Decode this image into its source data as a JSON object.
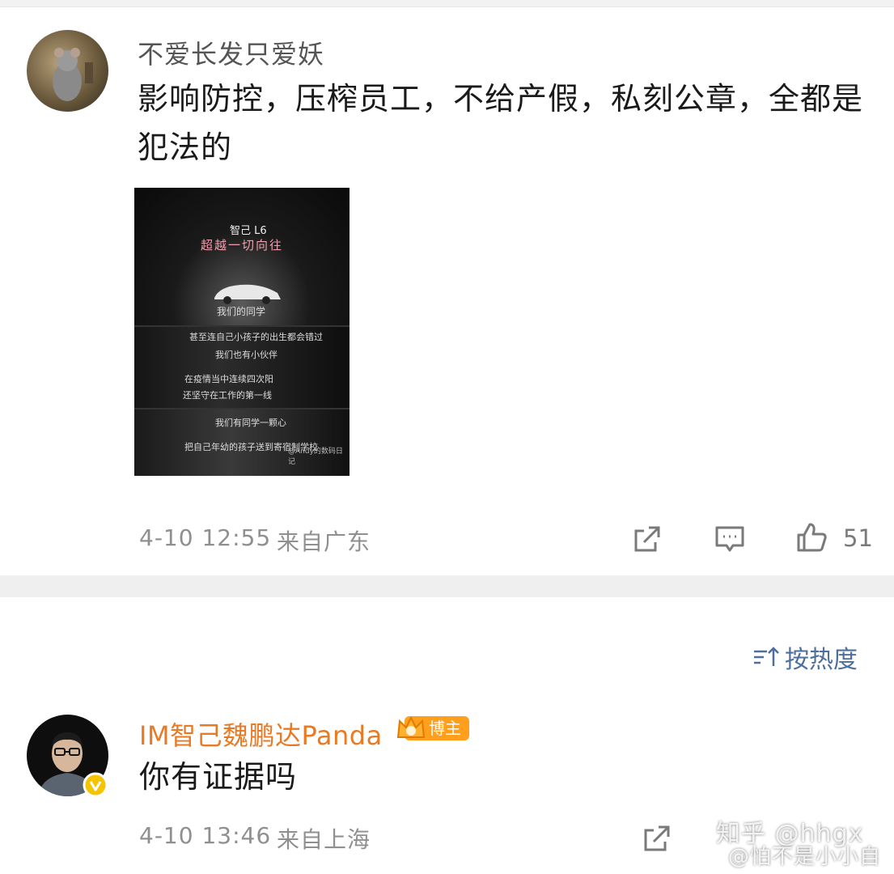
{
  "comment1": {
    "username": "不爱长发只爱妖",
    "text": "影响防控，压榨员工，不给产假，私刻公章，全都是犯法的",
    "image": {
      "brand": "智己 L6",
      "tagline": "超越一切向往",
      "lines": [
        "我们的同学",
        "甚至连自己小孩子的出生都会错过",
        "我们也有小伙伴",
        "在疫情当中连续四次阳",
        "还坚守在工作的第一线",
        "我们有同学一颗心",
        "把自己年幼的孩子送到寄宿制学校",
        "@Andy的数码日记"
      ]
    },
    "timestamp": "4-10 12:55",
    "location": "来自广东",
    "likes": "51"
  },
  "sort": {
    "label": "按热度"
  },
  "comment2": {
    "username": "IM智己魏鹏达Panda",
    "badge": "博主",
    "text": "你有证据吗",
    "timestamp": "4-10 13:46",
    "location": "来自上海"
  },
  "watermark": {
    "line1": "知乎 @hhgx",
    "line2": "@怕不是小小自"
  },
  "icons": [
    "repost-icon",
    "comment-icon",
    "like-icon",
    "sort-icon",
    "verified-icon"
  ],
  "colors": {
    "vip_name": "#e87a24",
    "badge": "#ff9f1c",
    "sort_link": "#4d6f9e",
    "verified": "#f5c400"
  }
}
